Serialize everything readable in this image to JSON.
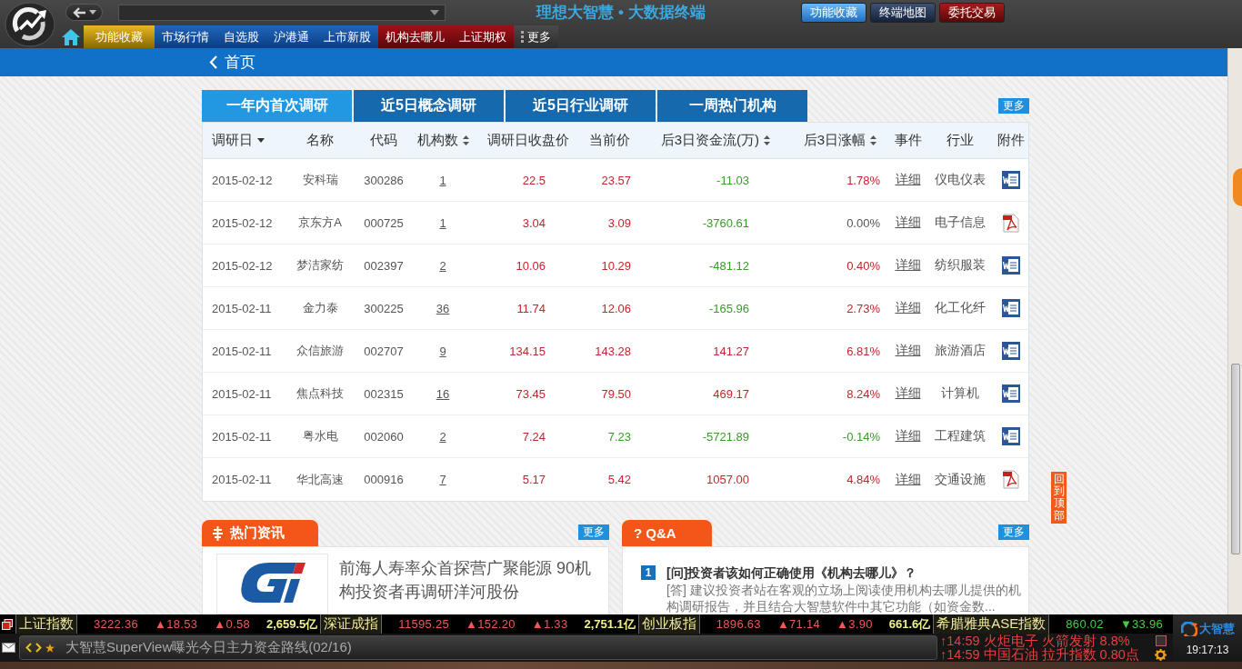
{
  "app_title": "理想大智慧 • 大数据终端",
  "top_buttons": [
    {
      "label": "功能收藏",
      "kind": "favorites"
    },
    {
      "label": "终端地图",
      "kind": "map"
    },
    {
      "label": "委托交易",
      "kind": "trade"
    }
  ],
  "nav_tabs": [
    {
      "label": "功能收藏",
      "kind": "favorites"
    },
    {
      "label": "市场行情",
      "kind": "market"
    },
    {
      "label": "自选股",
      "kind": "market"
    },
    {
      "label": "沪港通",
      "kind": "market"
    },
    {
      "label": "上市新股",
      "kind": "market"
    },
    {
      "label": "机构去哪儿",
      "kind": "institution"
    },
    {
      "label": "上证期权",
      "kind": "institution"
    },
    {
      "label": "更多",
      "kind": "more"
    }
  ],
  "breadcrumb": {
    "label": "首页"
  },
  "research_tabs": [
    {
      "label": "一年内首次调研",
      "selected": true
    },
    {
      "label": "近5日概念调研",
      "selected": false
    },
    {
      "label": "近5日行业调研",
      "selected": false
    },
    {
      "label": "一周热门机构",
      "selected": false
    }
  ],
  "research_more": "更多",
  "table": {
    "columns": [
      {
        "label": "调研日",
        "sorted": true
      },
      {
        "label": "名称"
      },
      {
        "label": "代码"
      },
      {
        "label": "机构数",
        "sorted": false
      },
      {
        "label": "调研日收盘价"
      },
      {
        "label": "当前价"
      },
      {
        "label": "后3日资金流(万)",
        "sorted": false
      },
      {
        "label": "后3日涨幅",
        "sorted": false
      },
      {
        "label": "事件"
      },
      {
        "label": "行业"
      },
      {
        "label": "附件"
      }
    ],
    "rows": [
      {
        "date": "2015-02-12",
        "name": "安科瑞",
        "code": "300286",
        "count": "1",
        "close": {
          "text": "22.5",
          "color": "#c0262c"
        },
        "price": {
          "text": "23.57",
          "color": "#c0262c"
        },
        "flow": {
          "text": "-11.03",
          "color": "#3a9a2a"
        },
        "change": {
          "text": "1.78%",
          "color": "#c0262c"
        },
        "event": "详细",
        "industry": "仪电仪表",
        "attachment": {
          "kind": "word"
        }
      },
      {
        "date": "2015-02-12",
        "name": "京东方A",
        "code": "000725",
        "count": "1",
        "close": {
          "text": "3.04",
          "color": "#c0262c"
        },
        "price": {
          "text": "3.09",
          "color": "#c0262c"
        },
        "flow": {
          "text": "-3760.61",
          "color": "#3a9a2a"
        },
        "change": {
          "text": "0.00%",
          "color": "#555555"
        },
        "event": "详细",
        "industry": "电子信息",
        "attachment": {
          "kind": "pdf"
        }
      },
      {
        "date": "2015-02-12",
        "name": "梦洁家纺",
        "code": "002397",
        "count": "2",
        "close": {
          "text": "10.06",
          "color": "#c0262c"
        },
        "price": {
          "text": "10.29",
          "color": "#c0262c"
        },
        "flow": {
          "text": "-481.12",
          "color": "#3a9a2a"
        },
        "change": {
          "text": "0.40%",
          "color": "#c0262c"
        },
        "event": "详细",
        "industry": "纺织服装",
        "attachment": {
          "kind": "word"
        }
      },
      {
        "date": "2015-02-11",
        "name": "金力泰",
        "code": "300225",
        "count": "36",
        "close": {
          "text": "11.74",
          "color": "#c0262c"
        },
        "price": {
          "text": "12.06",
          "color": "#c0262c"
        },
        "flow": {
          "text": "-165.96",
          "color": "#3a9a2a"
        },
        "change": {
          "text": "2.73%",
          "color": "#c0262c"
        },
        "event": "详细",
        "industry": "化工化纤",
        "attachment": {
          "kind": "word"
        }
      },
      {
        "date": "2015-02-11",
        "name": "众信旅游",
        "code": "002707",
        "count": "9",
        "close": {
          "text": "134.15",
          "color": "#c0262c"
        },
        "price": {
          "text": "143.28",
          "color": "#c0262c"
        },
        "flow": {
          "text": "141.27",
          "color": "#c0262c"
        },
        "change": {
          "text": "6.81%",
          "color": "#c0262c"
        },
        "event": "详细",
        "industry": "旅游酒店",
        "attachment": {
          "kind": "word"
        }
      },
      {
        "date": "2015-02-11",
        "name": "焦点科技",
        "code": "002315",
        "count": "16",
        "close": {
          "text": "73.45",
          "color": "#c0262c"
        },
        "price": {
          "text": "79.50",
          "color": "#c0262c"
        },
        "flow": {
          "text": "469.17",
          "color": "#c0262c"
        },
        "change": {
          "text": "8.24%",
          "color": "#c0262c"
        },
        "event": "详细",
        "industry": "计算机",
        "attachment": {
          "kind": "word"
        }
      },
      {
        "date": "2015-02-11",
        "name": "粤水电",
        "code": "002060",
        "count": "2",
        "close": {
          "text": "7.24",
          "color": "#c0262c"
        },
        "price": {
          "text": "7.23",
          "color": "#3a9a2a"
        },
        "flow": {
          "text": "-5721.89",
          "color": "#3a9a2a"
        },
        "change": {
          "text": "-0.14%",
          "color": "#3a9a2a"
        },
        "event": "详细",
        "industry": "工程建筑",
        "attachment": {
          "kind": "word"
        }
      },
      {
        "date": "2015-02-11",
        "name": "华北高速",
        "code": "000916",
        "count": "7",
        "close": {
          "text": "5.17",
          "color": "#c0262c"
        },
        "price": {
          "text": "5.42",
          "color": "#c0262c"
        },
        "flow": {
          "text": "1057.00",
          "color": "#c0262c"
        },
        "change": {
          "text": "4.84%",
          "color": "#c0262c"
        },
        "event": "详细",
        "industry": "交通设施",
        "attachment": {
          "kind": "pdf"
        }
      }
    ]
  },
  "news": {
    "title": "热门资讯",
    "more": "更多",
    "items": [
      {
        "headline": "前海人寿率众首探营广聚能源 90机构投资者再调研洋河股份"
      }
    ]
  },
  "qa": {
    "title": "? Q&A",
    "more": "更多",
    "items": [
      {
        "number": "1",
        "question": "[问]投资者该如何正确使用《机构去哪儿》？",
        "answer": "[答] 建议投资者站在客观的立场上阅读使用机构去哪儿提供的机构调研报告，并且结合大智慧软件中其它功能（如资金数..."
      }
    ]
  },
  "back_to_top": "回到顶部",
  "ticker": [
    {
      "name": "上证指数",
      "value": "3222.36",
      "change": "▲18.53",
      "percent": "▲0.58",
      "turnover": "2,659.5亿",
      "color": "#f05858"
    },
    {
      "name": "深证成指",
      "value": "11595.25",
      "change": "▲152.20",
      "percent": "▲1.33",
      "turnover": "2,751.1亿",
      "color": "#f05858"
    },
    {
      "name": "创业板指",
      "value": "1896.63",
      "change": "▲71.14",
      "percent": "▲3.90",
      "turnover": "661.6亿",
      "color": "#f05858"
    },
    {
      "name": "希腊雅典ASE指数",
      "value": "860.02",
      "change": "▼33.96",
      "color": "#40d040"
    }
  ],
  "news_bar": {
    "headline": "大智慧SuperView曝光今日主力资金路线(02/16)"
  },
  "alerts": [
    "↑14:59 火炬电子 火箭发射 8.8%",
    "↑14:59 中国石油 拉升指数 0.80点"
  ],
  "status": {
    "brand": "大智慧",
    "time": "19:17:13"
  }
}
